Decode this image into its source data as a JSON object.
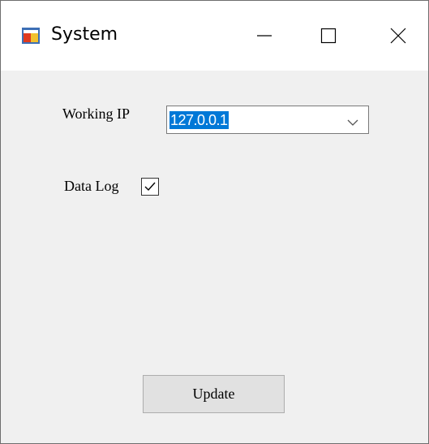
{
  "window": {
    "title": "System",
    "icon": "app-window-icon",
    "controls": {
      "minimize_icon": "minimize-icon",
      "maximize_icon": "maximize-icon",
      "close_icon": "close-icon"
    }
  },
  "form": {
    "working_ip_label": "Working IP",
    "working_ip_value": "127.0.0.1",
    "data_log_label": "Data Log",
    "data_log_checked": true,
    "update_label": "Update"
  },
  "colors": {
    "selection": "#0078d7",
    "window_bg": "#f0f0f0",
    "titlebar_bg": "#ffffff"
  }
}
